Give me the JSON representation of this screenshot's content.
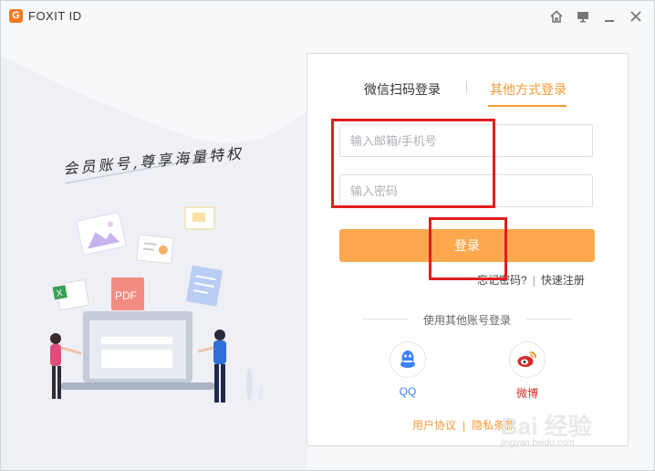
{
  "app": {
    "title": "FOXIT ID",
    "logo": "G"
  },
  "titlebar_icons": [
    "home-icon",
    "monitor-icon",
    "minimize-icon",
    "close-icon"
  ],
  "slogan": "会员账号,尊享海量特权",
  "tabs": {
    "wechat": "微信扫码登录",
    "other": "其他方式登录"
  },
  "form": {
    "email_placeholder": "输入邮箱/手机号",
    "password_placeholder": "输入密码",
    "login_label": "登录",
    "forgot": "忘记密码?",
    "register": "快速注册"
  },
  "other_login": {
    "label": "使用其他账号登录",
    "qq": "QQ",
    "weibo": "微博"
  },
  "footer": {
    "agreement": "用户协议",
    "privacy": "隐私条款"
  },
  "watermark": {
    "text": "Bai 经验",
    "url": "jingyan.baidu.com"
  },
  "colors": {
    "accent": "#f39a36",
    "button": "#fba84e",
    "annotation": "#e01e1e",
    "qq": "#3b82f6",
    "weibo": "#d52b2b"
  }
}
